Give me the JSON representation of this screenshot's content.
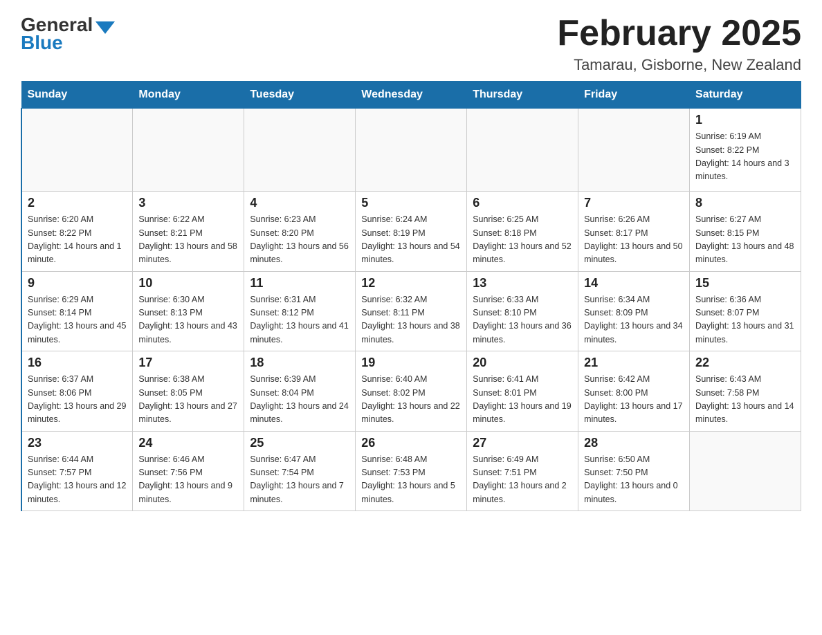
{
  "header": {
    "logo_general": "General",
    "logo_blue": "Blue",
    "title": "February 2025",
    "subtitle": "Tamarau, Gisborne, New Zealand"
  },
  "weekdays": [
    "Sunday",
    "Monday",
    "Tuesday",
    "Wednesday",
    "Thursday",
    "Friday",
    "Saturday"
  ],
  "weeks": [
    [
      {
        "day": "",
        "info": ""
      },
      {
        "day": "",
        "info": ""
      },
      {
        "day": "",
        "info": ""
      },
      {
        "day": "",
        "info": ""
      },
      {
        "day": "",
        "info": ""
      },
      {
        "day": "",
        "info": ""
      },
      {
        "day": "1",
        "info": "Sunrise: 6:19 AM\nSunset: 8:22 PM\nDaylight: 14 hours and 3 minutes."
      }
    ],
    [
      {
        "day": "2",
        "info": "Sunrise: 6:20 AM\nSunset: 8:22 PM\nDaylight: 14 hours and 1 minute."
      },
      {
        "day": "3",
        "info": "Sunrise: 6:22 AM\nSunset: 8:21 PM\nDaylight: 13 hours and 58 minutes."
      },
      {
        "day": "4",
        "info": "Sunrise: 6:23 AM\nSunset: 8:20 PM\nDaylight: 13 hours and 56 minutes."
      },
      {
        "day": "5",
        "info": "Sunrise: 6:24 AM\nSunset: 8:19 PM\nDaylight: 13 hours and 54 minutes."
      },
      {
        "day": "6",
        "info": "Sunrise: 6:25 AM\nSunset: 8:18 PM\nDaylight: 13 hours and 52 minutes."
      },
      {
        "day": "7",
        "info": "Sunrise: 6:26 AM\nSunset: 8:17 PM\nDaylight: 13 hours and 50 minutes."
      },
      {
        "day": "8",
        "info": "Sunrise: 6:27 AM\nSunset: 8:15 PM\nDaylight: 13 hours and 48 minutes."
      }
    ],
    [
      {
        "day": "9",
        "info": "Sunrise: 6:29 AM\nSunset: 8:14 PM\nDaylight: 13 hours and 45 minutes."
      },
      {
        "day": "10",
        "info": "Sunrise: 6:30 AM\nSunset: 8:13 PM\nDaylight: 13 hours and 43 minutes."
      },
      {
        "day": "11",
        "info": "Sunrise: 6:31 AM\nSunset: 8:12 PM\nDaylight: 13 hours and 41 minutes."
      },
      {
        "day": "12",
        "info": "Sunrise: 6:32 AM\nSunset: 8:11 PM\nDaylight: 13 hours and 38 minutes."
      },
      {
        "day": "13",
        "info": "Sunrise: 6:33 AM\nSunset: 8:10 PM\nDaylight: 13 hours and 36 minutes."
      },
      {
        "day": "14",
        "info": "Sunrise: 6:34 AM\nSunset: 8:09 PM\nDaylight: 13 hours and 34 minutes."
      },
      {
        "day": "15",
        "info": "Sunrise: 6:36 AM\nSunset: 8:07 PM\nDaylight: 13 hours and 31 minutes."
      }
    ],
    [
      {
        "day": "16",
        "info": "Sunrise: 6:37 AM\nSunset: 8:06 PM\nDaylight: 13 hours and 29 minutes."
      },
      {
        "day": "17",
        "info": "Sunrise: 6:38 AM\nSunset: 8:05 PM\nDaylight: 13 hours and 27 minutes."
      },
      {
        "day": "18",
        "info": "Sunrise: 6:39 AM\nSunset: 8:04 PM\nDaylight: 13 hours and 24 minutes."
      },
      {
        "day": "19",
        "info": "Sunrise: 6:40 AM\nSunset: 8:02 PM\nDaylight: 13 hours and 22 minutes."
      },
      {
        "day": "20",
        "info": "Sunrise: 6:41 AM\nSunset: 8:01 PM\nDaylight: 13 hours and 19 minutes."
      },
      {
        "day": "21",
        "info": "Sunrise: 6:42 AM\nSunset: 8:00 PM\nDaylight: 13 hours and 17 minutes."
      },
      {
        "day": "22",
        "info": "Sunrise: 6:43 AM\nSunset: 7:58 PM\nDaylight: 13 hours and 14 minutes."
      }
    ],
    [
      {
        "day": "23",
        "info": "Sunrise: 6:44 AM\nSunset: 7:57 PM\nDaylight: 13 hours and 12 minutes."
      },
      {
        "day": "24",
        "info": "Sunrise: 6:46 AM\nSunset: 7:56 PM\nDaylight: 13 hours and 9 minutes."
      },
      {
        "day": "25",
        "info": "Sunrise: 6:47 AM\nSunset: 7:54 PM\nDaylight: 13 hours and 7 minutes."
      },
      {
        "day": "26",
        "info": "Sunrise: 6:48 AM\nSunset: 7:53 PM\nDaylight: 13 hours and 5 minutes."
      },
      {
        "day": "27",
        "info": "Sunrise: 6:49 AM\nSunset: 7:51 PM\nDaylight: 13 hours and 2 minutes."
      },
      {
        "day": "28",
        "info": "Sunrise: 6:50 AM\nSunset: 7:50 PM\nDaylight: 13 hours and 0 minutes."
      },
      {
        "day": "",
        "info": ""
      }
    ]
  ]
}
